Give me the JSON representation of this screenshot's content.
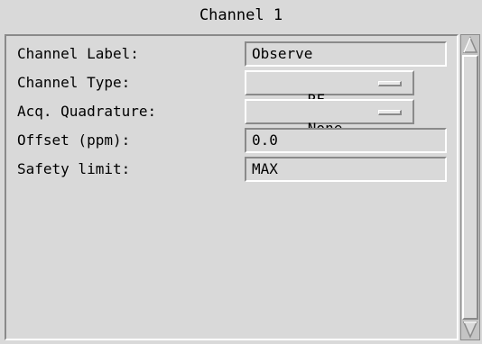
{
  "window": {
    "title": "Channel 1"
  },
  "form": {
    "channel_label": {
      "label": "Channel Label:",
      "value": "Observe"
    },
    "channel_type": {
      "label": "Channel Type:",
      "value": "RF"
    },
    "acq_quadrature": {
      "label": "Acq. Quadrature:",
      "value": "None"
    },
    "offset": {
      "label": "Offset (ppm):",
      "value": "0.0"
    },
    "safety_limit": {
      "label": "Safety limit:",
      "value": "MAX"
    }
  },
  "icons": {
    "scroll_up": "triangle-up-icon",
    "scroll_down": "triangle-down-icon",
    "option_menu": "option-menu-indicator-icon"
  }
}
